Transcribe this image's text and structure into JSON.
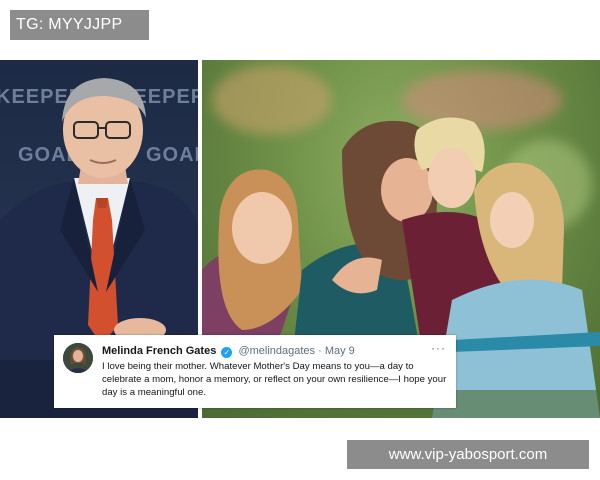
{
  "watermark_top": "TG: MYYJJPP",
  "watermark_bottom": "www.vip-yabosport.com",
  "left_photo": {
    "banner_line1_a": "KEEPERS",
    "banner_line1_b": "KEEPERS",
    "banner_line2_a": "GOALKEE",
    "banner_line2_b": "GOALKEE"
  },
  "tweet": {
    "author_name": "Melinda French Gates",
    "handle": "@melindagates",
    "separator": "·",
    "date": "May 9",
    "more_label": "···",
    "text": "I love being their mother. Whatever Mother's Day means to you—a day to celebrate a mom, honor a memory, or reflect on your own resilience—I hope your day is a meaningful one."
  },
  "colors": {
    "twitter_blue": "#1da1f2",
    "watermark_bg": "#8c8c8c"
  }
}
